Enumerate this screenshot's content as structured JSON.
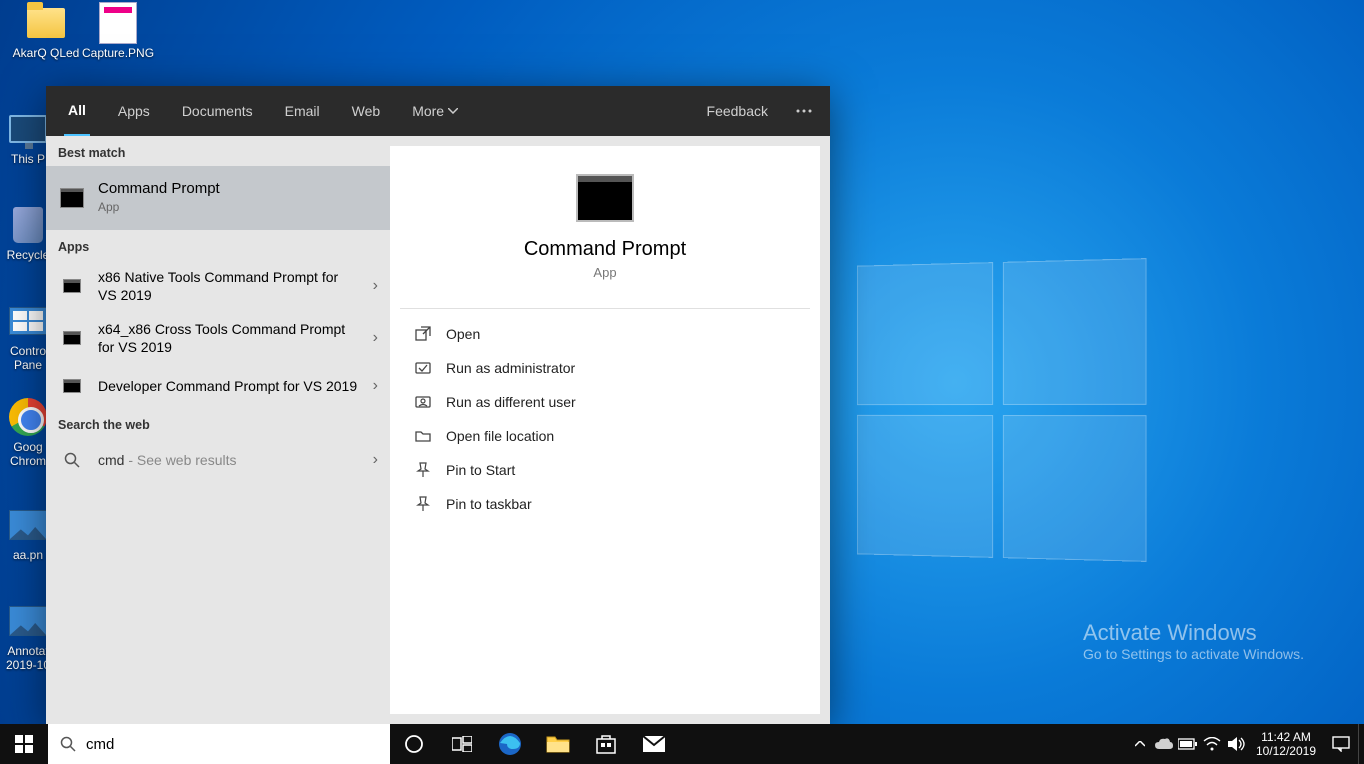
{
  "desktop_icons": {
    "i0": "AkarQ QLed",
    "i1": "Capture.PNG",
    "i2": "This P",
    "i3": "Recycle",
    "i4": "Contro\nPane",
    "i5": "Goog\nChrom",
    "i6": "aa.pn",
    "i7": "Annotat\n2019-10"
  },
  "search_panel": {
    "tabs": {
      "all": "All",
      "apps": "Apps",
      "documents": "Documents",
      "email": "Email",
      "web": "Web",
      "more": "More",
      "feedback": "Feedback"
    },
    "sections": {
      "best_match": "Best match",
      "apps": "Apps",
      "search_web": "Search the web"
    },
    "best_match": {
      "title": "Command Prompt",
      "sub": "App"
    },
    "apps_list": [
      "x86 Native Tools Command Prompt for VS 2019",
      "x64_x86 Cross Tools Command Prompt for VS 2019",
      "Developer Command Prompt for VS 2019"
    ],
    "web_query": {
      "q": "cmd",
      "suffix": " - See web results"
    },
    "preview": {
      "title": "Command Prompt",
      "sub": "App",
      "actions": [
        "Open",
        "Run as administrator",
        "Run as different user",
        "Open file location",
        "Pin to Start",
        "Pin to taskbar"
      ]
    }
  },
  "search_input": "cmd",
  "activation": {
    "title": "Activate Windows",
    "sub": "Go to Settings to activate Windows."
  },
  "tray": {
    "time": "11:42 AM",
    "date": "10/12/2019"
  }
}
